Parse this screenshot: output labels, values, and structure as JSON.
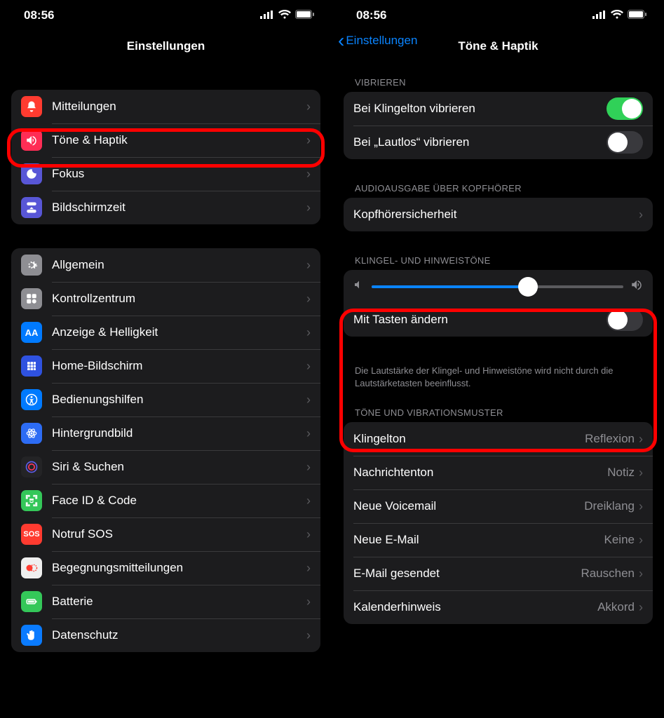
{
  "status": {
    "time": "08:56"
  },
  "left": {
    "title": "Einstellungen",
    "group1": [
      {
        "label": "Mitteilungen"
      },
      {
        "label": "Töne & Haptik"
      },
      {
        "label": "Fokus"
      },
      {
        "label": "Bildschirmzeit"
      }
    ],
    "group2": [
      {
        "label": "Allgemein"
      },
      {
        "label": "Kontrollzentrum"
      },
      {
        "label": "Anzeige & Helligkeit"
      },
      {
        "label": "Home-Bildschirm"
      },
      {
        "label": "Bedienungshilfen"
      },
      {
        "label": "Hintergrundbild"
      },
      {
        "label": "Siri & Suchen"
      },
      {
        "label": "Face ID & Code"
      },
      {
        "label": "Notruf SOS"
      },
      {
        "label": "Begegnungsmitteilungen"
      },
      {
        "label": "Batterie"
      },
      {
        "label": "Datenschutz"
      }
    ]
  },
  "right": {
    "back": "Einstellungen",
    "title": "Töne & Haptik",
    "sec_vibrate_header": "VIBRIEREN",
    "vibrate_ring": {
      "label": "Bei Klingelton vibrieren",
      "on": true
    },
    "vibrate_silent": {
      "label": "Bei „Lautlos“ vibrieren",
      "on": false
    },
    "sec_headphone_header": "AUDIOAUSGABE ÜBER KOPFHÖRER",
    "headphone_safety": "Kopfhörersicherheit",
    "sec_ringer_header": "KLINGEL- UND HINWEISTÖNE",
    "ringer_slider_pct": 62,
    "change_with_buttons": {
      "label": "Mit Tasten ändern",
      "on": false
    },
    "ringer_footer": "Die Lautstärke der Klingel- und Hinweistöne wird nicht durch die Lautstärketasten beeinflusst.",
    "sec_sounds_header": "TÖNE UND VIBRATIONSMUSTER",
    "sounds": [
      {
        "label": "Klingelton",
        "value": "Reflexion"
      },
      {
        "label": "Nachrichtenton",
        "value": "Notiz"
      },
      {
        "label": "Neue Voicemail",
        "value": "Dreiklang"
      },
      {
        "label": "Neue E-Mail",
        "value": "Keine"
      },
      {
        "label": "E-Mail gesendet",
        "value": "Rauschen"
      },
      {
        "label": "Kalenderhinweis",
        "value": "Akkord"
      }
    ]
  }
}
